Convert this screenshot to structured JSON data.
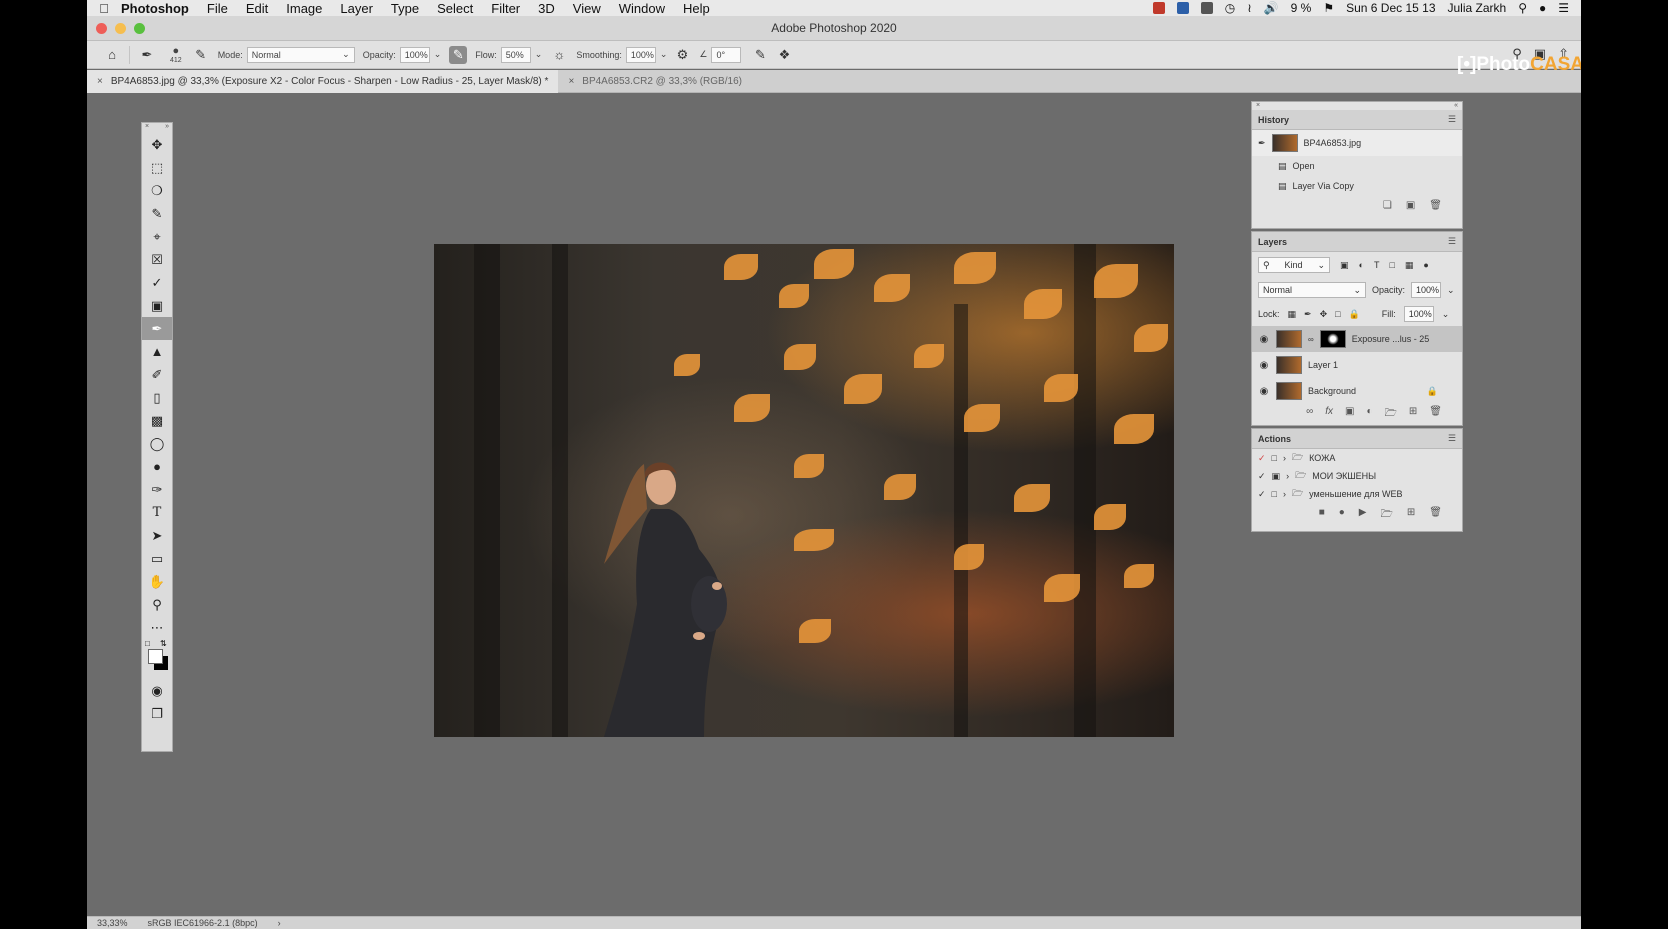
{
  "menubar": {
    "app": "Photoshop",
    "items": [
      "File",
      "Edit",
      "Image",
      "Layer",
      "Type",
      "Select",
      "Filter",
      "3D",
      "View",
      "Window",
      "Help"
    ],
    "battery": "9 %",
    "datetime": "Sun 6 Dec 15 13",
    "user": "Julia Zarkh"
  },
  "window": {
    "title": "Adobe Photoshop 2020"
  },
  "options": {
    "brush_size": "412",
    "mode_label": "Mode:",
    "mode_value": "Normal",
    "opacity_label": "Opacity:",
    "opacity_value": "100%",
    "flow_label": "Flow:",
    "flow_value": "50%",
    "smoothing_label": "Smoothing:",
    "smoothing_value": "100%",
    "angle_value": "0°"
  },
  "watermark": {
    "bracket": "[•]",
    "photo": "Photo",
    "casa": "CASA"
  },
  "tabs": [
    {
      "label": "BP4A6853.jpg @ 33,3% (Exposure X2 - Color Focus - Sharpen - Low Radius - 25, Layer Mask/8) *",
      "active": true
    },
    {
      "label": "BP4A6853.CR2 @ 33,3% (RGB/16)",
      "active": false
    }
  ],
  "history": {
    "title": "History",
    "snapshot": "BP4A6853.jpg",
    "items": [
      "Open",
      "Layer Via Copy"
    ]
  },
  "layers": {
    "title": "Layers",
    "filter": "Kind",
    "blend": "Normal",
    "opacity_label": "Opacity:",
    "opacity": "100%",
    "lock_label": "Lock:",
    "fill_label": "Fill:",
    "fill": "100%",
    "items": [
      {
        "name": "Exposure ...lus - 25",
        "selected": true,
        "mask": true
      },
      {
        "name": "Layer 1",
        "selected": false,
        "mask": false
      },
      {
        "name": "Background",
        "selected": false,
        "mask": false
      }
    ]
  },
  "actions": {
    "title": "Actions",
    "items": [
      "КОЖА",
      "МОИ ЭКШЕНЫ",
      "уменьшение для WEB"
    ]
  },
  "status": {
    "zoom": "33,33%",
    "profile": "sRGB IEC61966-2.1 (8bpc)"
  },
  "colors": {
    "accent": "#f2a533",
    "canvas_bg": "#6c6c6c"
  }
}
